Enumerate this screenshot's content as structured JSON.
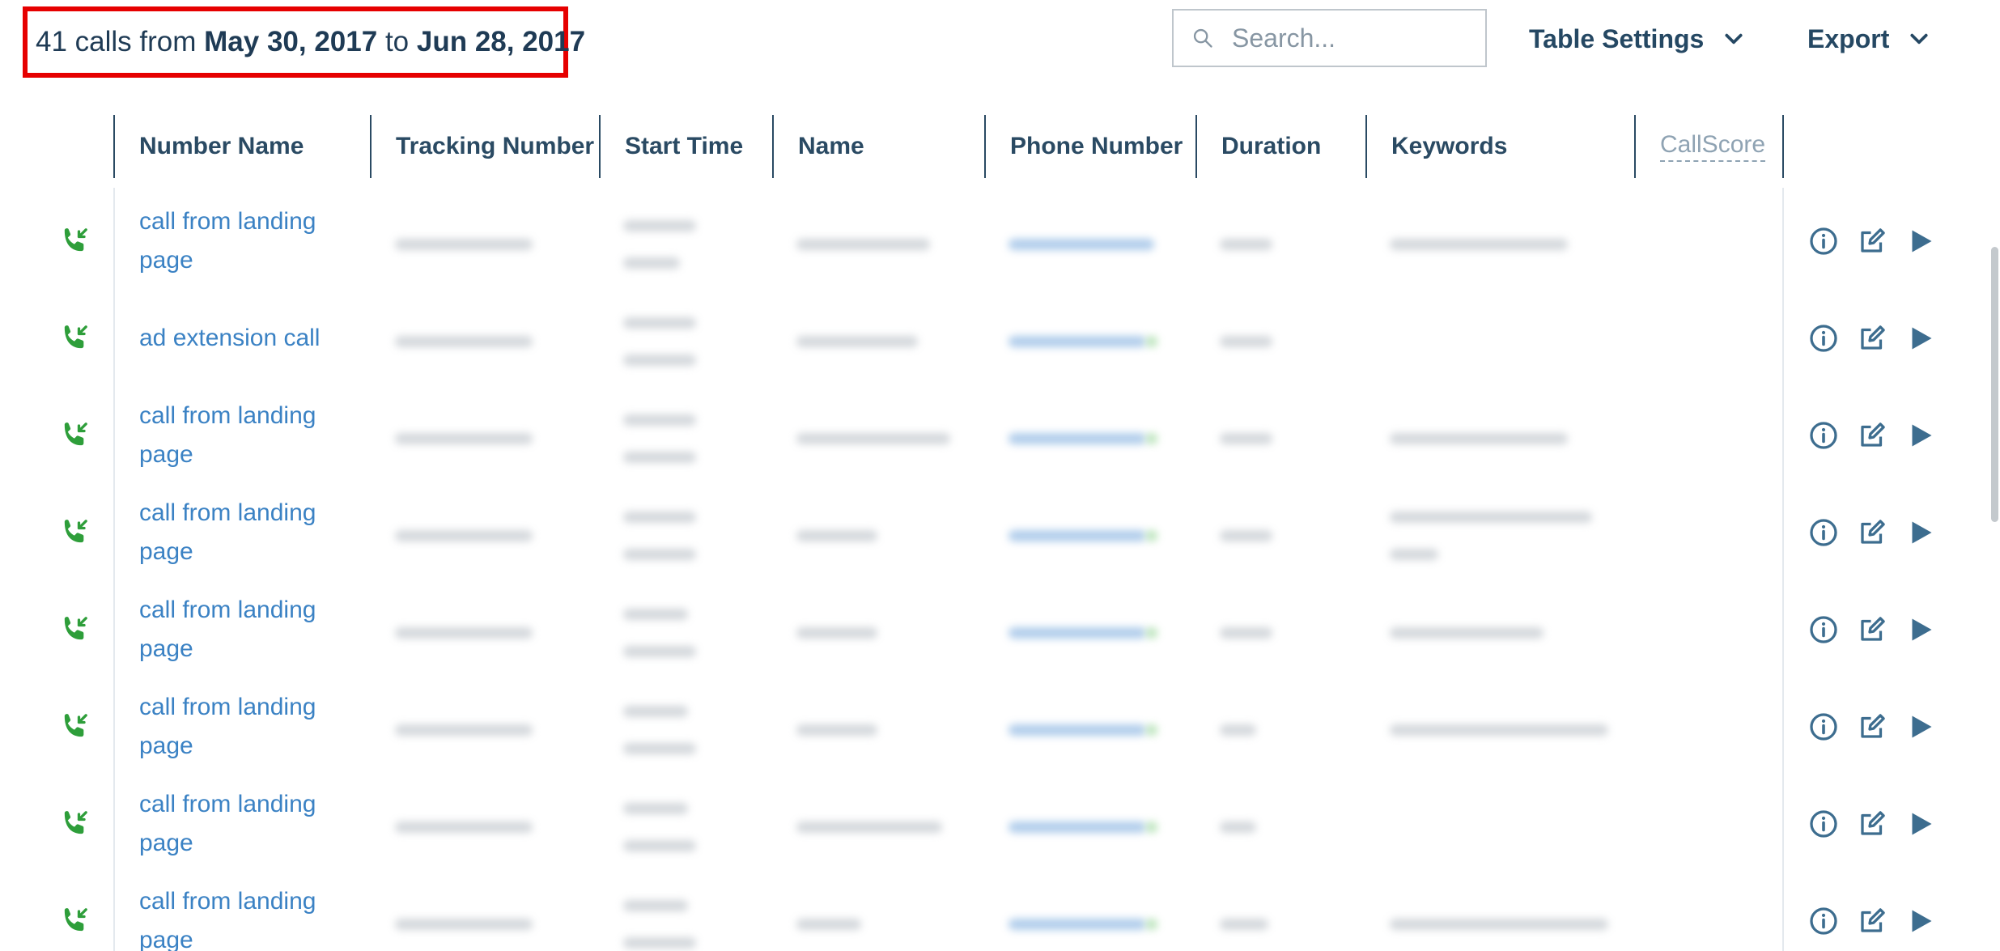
{
  "summary": {
    "prefix": "41 calls from",
    "start_date": "May 30, 2017",
    "connector": "to",
    "end_date": "Jun 28, 2017"
  },
  "search": {
    "placeholder": "Search..."
  },
  "toolbar": {
    "table_settings_label": "Table Settings",
    "export_label": "Export"
  },
  "table": {
    "columns": [
      "Number Name",
      "Tracking Number",
      "Start Time",
      "Name",
      "Phone Number",
      "Duration",
      "Keywords",
      "CallScore"
    ],
    "rows": [
      {
        "number_name": "call from landing page"
      },
      {
        "number_name": "ad extension call"
      },
      {
        "number_name": "call from landing page"
      },
      {
        "number_name": "call from landing page"
      },
      {
        "number_name": "call from landing page"
      },
      {
        "number_name": "call from landing page"
      },
      {
        "number_name": "call from landing page"
      },
      {
        "number_name": "call from landing page"
      }
    ]
  },
  "icons": {
    "row_status": "incoming-call-icon",
    "row_actions": [
      "info-icon",
      "edit-icon",
      "play-icon"
    ],
    "search": "search-icon",
    "dropdown": "chevron-down-icon"
  },
  "colors": {
    "accent_link": "#3b82c4",
    "header_text": "#2a4a63",
    "call_icon": "#2e9e3a",
    "highlight_border": "#e60000",
    "action_icon": "#3d6d8f"
  }
}
